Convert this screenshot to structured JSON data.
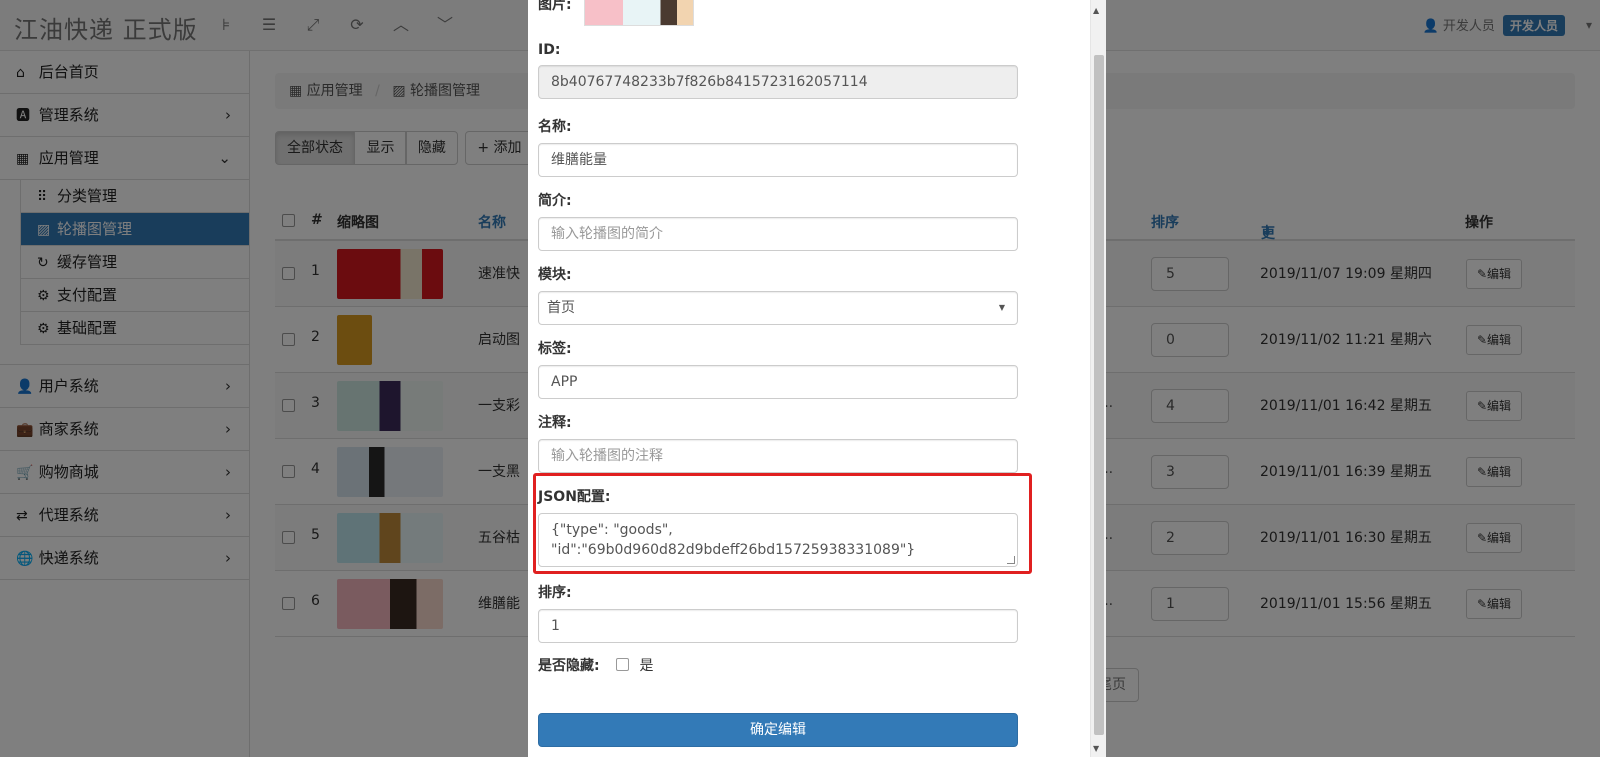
{
  "app": {
    "brand": "江油快递 正式版"
  },
  "topbar": {
    "icons": [
      "columns-icon",
      "list-icon",
      "fullscreen-icon",
      "refresh-icon",
      "chevron-up-icon",
      "chevron-down-icon"
    ],
    "user_label": "开发人员",
    "user_badge": "开发人员"
  },
  "sidebar": {
    "items": [
      {
        "label": "后台首页",
        "icon": "home-icon"
      },
      {
        "label": "管理系统",
        "icon": "admin-icon"
      },
      {
        "label": "应用管理",
        "icon": "grid-icon"
      }
    ],
    "subitems": [
      {
        "label": "分类管理",
        "icon": "th-icon"
      },
      {
        "label": "轮播图管理",
        "icon": "picture-icon"
      },
      {
        "label": "缓存管理",
        "icon": "refresh-icon"
      },
      {
        "label": "支付配置",
        "icon": "cog-icon"
      },
      {
        "label": "基础配置",
        "icon": "cog-icon"
      }
    ],
    "items2": [
      {
        "label": "用户系统",
        "icon": "user-icon"
      },
      {
        "label": "商家系统",
        "icon": "briefcase-icon"
      },
      {
        "label": "购物商城",
        "icon": "cart-icon"
      },
      {
        "label": "代理系统",
        "icon": "retweet-icon"
      },
      {
        "label": "快递系统",
        "icon": "globe-icon"
      }
    ]
  },
  "main": {
    "breadcrumb": [
      "应用管理",
      "轮播图管理"
    ],
    "filters": [
      "全部状态",
      "显示",
      "隐藏"
    ],
    "add_label": "添加",
    "table": {
      "headers": [
        "#",
        "缩略图",
        "名称",
        "排序",
        "更新时间",
        "操作"
      ],
      "rows": [
        {
          "num": "1",
          "name": "速准快",
          "sort": "5",
          "time": "2019/11/07 19:09 星期四",
          "extra": ""
        },
        {
          "num": "2",
          "name": "启动图",
          "sort": "0",
          "time": "2019/11/02 11:21 星期六",
          "extra": ""
        },
        {
          "num": "3",
          "name": "一支彩",
          "sort": "4",
          "time": "2019/11/01 16:42 星期五",
          "extra": "id..."
        },
        {
          "num": "4",
          "name": "一支黑",
          "sort": "3",
          "time": "2019/11/01 16:39 星期五",
          "extra": "id..."
        },
        {
          "num": "5",
          "name": "五谷枯",
          "sort": "2",
          "time": "2019/11/01 16:30 星期五",
          "extra": "id..."
        },
        {
          "num": "6",
          "name": "维膳能",
          "sort": "1",
          "time": "2019/11/01 15:56 星期五",
          "extra": "id..."
        }
      ],
      "edit_label": "编辑"
    },
    "pager_last": "尾页"
  },
  "modal": {
    "image_label": "图片:",
    "id_label": "ID:",
    "id_value": "8b40767748233b7f826b8415723162057114",
    "name_label": "名称:",
    "name_value": "维膳能量",
    "desc_label": "简介:",
    "desc_placeholder": "输入轮播图的简介",
    "module_label": "模块:",
    "module_value": "首页",
    "tag_label": "标签:",
    "tag_value": "APP",
    "note_label": "注释:",
    "note_placeholder": "输入轮播图的注释",
    "json_label": "JSON配置:",
    "json_line1": "{\"type\": \"goods\",",
    "json_line2": "\"id\":\"69b0d960d82d9bdeff26bd15725938331089\"}",
    "sort_label": "排序:",
    "sort_value": "1",
    "hidden_label": "是否隐藏:",
    "hidden_option": "是",
    "submit_label": "确定编辑"
  },
  "colors": {
    "primary": "#337ab7",
    "highlight": "#e02020"
  }
}
